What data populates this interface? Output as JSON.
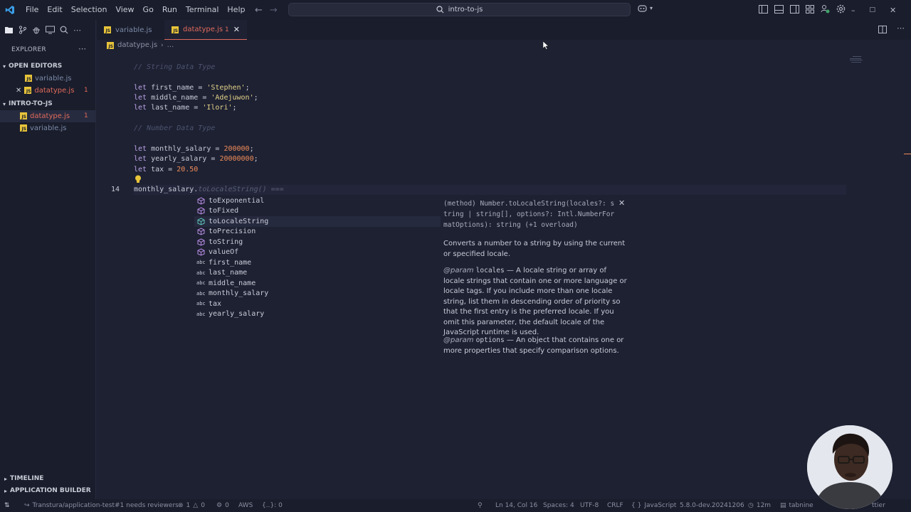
{
  "titlebar": {
    "menu": [
      "File",
      "Edit",
      "Selection",
      "View",
      "Go",
      "Run",
      "Terminal",
      "Help"
    ],
    "search": "intro-to-js"
  },
  "sidebar": {
    "title": "EXPLORER",
    "open_editors": {
      "label": "OPEN EDITORS",
      "items": [
        {
          "name": "variable.js"
        },
        {
          "name": "datatype.js",
          "badge": "1"
        }
      ]
    },
    "folder": {
      "label": "INTRO-TO-JS",
      "items": [
        {
          "name": "datatype.js",
          "badge": "1"
        },
        {
          "name": "variable.js"
        }
      ]
    },
    "timeline": "TIMELINE",
    "app_builder": "APPLICATION BUILDER"
  },
  "tabs": [
    {
      "name": "variable.js"
    },
    {
      "name": "datatype.js",
      "badge": "1"
    }
  ],
  "breadcrumb": {
    "file": "datatype.js",
    "rest": "..."
  },
  "editor": {
    "current_line_number": "14",
    "comment1": "// String Data Type",
    "comment2": "// Number Data Type",
    "kw": "let",
    "eq": " = ",
    "semi": ";",
    "v_first": "first_name",
    "s_first": "'Stephen'",
    "v_middle": "middle_name",
    "s_middle": "'Adejuwon'",
    "v_last": "last_name",
    "s_last": "'Ilori'",
    "v_monthly": "monthly_salary",
    "n_monthly": "200000",
    "v_yearly": "yearly_salary",
    "n_yearly": "20000000",
    "v_tax": "tax",
    "n_tax": "20.50",
    "line14_typed": "monthly_salary.",
    "line14_ghost": "toLocaleString() ==="
  },
  "suggestions": [
    {
      "kind": "method",
      "label": "toExponential"
    },
    {
      "kind": "method",
      "label": "toFixed"
    },
    {
      "kind": "method",
      "label": "toLocaleString"
    },
    {
      "kind": "method",
      "label": "toPrecision"
    },
    {
      "kind": "method",
      "label": "toString"
    },
    {
      "kind": "method",
      "label": "valueOf"
    },
    {
      "kind": "abc",
      "label": "first_name"
    },
    {
      "kind": "abc",
      "label": "last_name"
    },
    {
      "kind": "abc",
      "label": "middle_name"
    },
    {
      "kind": "abc",
      "label": "monthly_salary"
    },
    {
      "kind": "abc",
      "label": "tax"
    },
    {
      "kind": "abc",
      "label": "yearly_salary"
    }
  ],
  "suggestion_abc_text": "abc",
  "docs": {
    "sig_line1": "(method) Number.toLocaleString(locales?: s",
    "sig_line2": "tring | string[], options?: Intl.NumberFor",
    "sig_line3": "matOptions): string (+1 overload)",
    "description": "Converts a number to a string by using the current or specified locale.",
    "param_tag": "@param",
    "param1_name": "locales",
    "param1_desc": " — A locale string or array of locale strings that contain one or more language or locale tags. If you include more than one locale string, list them in descending order of priority so that the first entry is the preferred locale. If you omit this parameter, the default locale of the JavaScript runtime is used.",
    "param2_name": "options",
    "param2_desc": " — An object that contains one or more properties that specify comparison options."
  },
  "statusbar": {
    "branch": "Transtura/application-test#1 needs reviewers",
    "errors": "1",
    "warnings": "0",
    "ports": "0",
    "aws": "AWS",
    "braces": "{..}: 0",
    "position": "Ln 14, Col 16",
    "spaces": "Spaces: 4",
    "encoding": "UTF-8",
    "eol": "CRLF",
    "language": "JavaScript",
    "version": "5.8.0-dev.20241206",
    "time": "12m",
    "tabnine": "tabnine",
    "prettier": "ttier"
  },
  "colors": {
    "accent_error": "#e06b5c",
    "js_yellow": "#e8c43a",
    "method_purple": "#b58be0"
  }
}
